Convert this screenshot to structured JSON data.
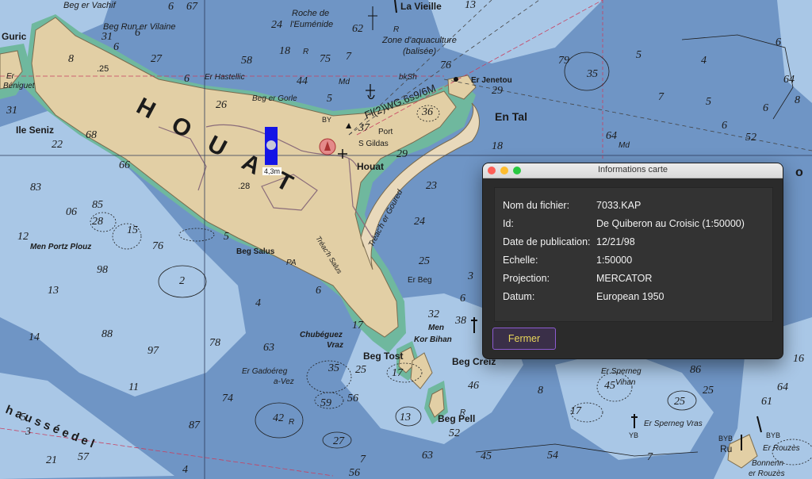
{
  "chart": {
    "places": {
      "houat": "H O U A T",
      "houat_port": "Houat",
      "guric": "Guric",
      "ile_seniz": "Ile Seniz",
      "beg_er_vachif": "Beg er Vachif",
      "beg_run_er_vilaine": "Beg Run er Vilaine",
      "roche_eumenide_1": "Roche de",
      "roche_eumenide_2": "l'Euménide",
      "la_vieille": "La Vieille",
      "zone_aquaculture_1": "Zone d'aquaculture",
      "zone_aquaculture_2": "(balisée)",
      "er_hastellic": "Er Hastellic",
      "beg_er_gorle": "Beg er Gorle",
      "er_beniguet_1": "Er",
      "er_beniguet_2": "Béniguet",
      "er_jenetou": "Er Jenetou",
      "en_tal": "En Tal",
      "port": "Port",
      "st_gildas": "S Gildas",
      "light": "Fl(2)WG.6s9/6M",
      "treach_er_goured": "Tréac'h er Goured",
      "treach_er_salus": "Tréac'h Salus",
      "men_portz_plouz": "Men Portz Plouz",
      "beg_salus": "Beg Salus",
      "er_beg": "Er Beg",
      "beg_creiz": "Beg Creiz",
      "beg_tost": "Beg Tost",
      "beg_pell": "Beg Pell",
      "chubeguez_1": "Chubéguez",
      "chubeguez_2": "Vraz",
      "men_kor_bihan_1": "Men",
      "men_kor_bihan_2": "Kor Bihan",
      "er_gadoereg_1": "Er Gadoéreg",
      "er_gadoereg_2": "a-Vez",
      "er_sperneg_vihan_1": "Er Sperneg",
      "er_sperneg_vihan_2": "Vihan",
      "er_sperneg_vras": "Er Sperneg Vras",
      "er_rouzes": "Er Rouzès",
      "bonnenn_1": "Bonnenn",
      "bonnenn_2": "er Rouzès",
      "chaussee": "h a u s s é e   d e   l",
      "by": "BY",
      "yb": "YB",
      "byb_1": "BYB",
      "byb_2": "BYB",
      "ru": "Ru",
      "md_1": "Md",
      "md_2": "Md",
      "bksh": "bkSh",
      "pa": "PA",
      "r_1": "R",
      "r_2": "R",
      "r_3": "R",
      "r_4": "R",
      "edge_o": "o"
    },
    "soundings": {
      "s1": "6",
      "s2": "67",
      "s3": "24",
      "s4": "62",
      "s5": "13",
      "s6": "57",
      "s7": "31",
      "s8": "27",
      "s9": "58",
      "s10": "18",
      "s11": "75",
      "s12": "7",
      "s13": "45",
      "s14": "4",
      "s15": "44",
      "s16": "76",
      "s17": "6",
      "s18": "5",
      "s19": "6",
      "s20": "6",
      "s21": "8",
      "s22": "4",
      "s23": "7",
      "s24": "21",
      "s25": "26",
      "s26": "56",
      "s27": "29",
      "s28": "7",
      "s29": "23",
      "s30": "36",
      "s31": "29",
      "s32": "37",
      "s33": "18",
      "s34": "3",
      "s35": "54",
      "s36": "79",
      "s37": "35",
      "s38": "5",
      "s39": "4",
      "s40": "6",
      "s41": "64",
      "s42": "68",
      "s43": "22",
      "s44": "66",
      "s45": "83",
      "s46": "85",
      "s47": "06",
      "s48": "28",
      "s49": "15",
      "s50": "12",
      "s51": "76",
      "s52": "98",
      "s53": "2",
      "s54": "25",
      "s55": "5",
      "s56": "24",
      "s57": "13",
      "s58": "14",
      "s59": "88",
      "s60": "78",
      "s61": "97",
      "s62": "63",
      "s63": "74",
      "s64": "11",
      "s65": "42",
      "s66": "87",
      "s67": "27",
      "s68": "63",
      "s69": "35",
      "s70": "59",
      "s71": "56",
      "s72": "25",
      "s73": "32",
      "s74": "38",
      "s75": "6",
      "s76": "17",
      "s77": "17",
      "s78": "13",
      "s79": "46",
      "s80": "52",
      "s81": "5",
      "s82": "8",
      "s83": "45",
      "s84": "17",
      "s85": "86",
      "s86": "25",
      "s87": "16",
      "s88": "61",
      "s89": "64",
      "s90": "6",
      "s91": "7",
      "s92": "64",
      "s93": "8",
      "s94": "6",
      "s95": "52",
      "s96": "5",
      "s97": "25",
      "s98": "28",
      "s99": "32",
      "s100": "3",
      "s101": "3",
      "s102": "5",
      "s103": "6",
      "s104": "31"
    },
    "heights": {
      "h1": ".25",
      "h2": ".28"
    }
  },
  "marker": {
    "label": "4,3m"
  },
  "dialog": {
    "title": "Informations carte",
    "rows": [
      {
        "key": "Nom du fichier:",
        "value": "7033.KAP"
      },
      {
        "key": "Id:",
        "value": "De Quiberon au Croisic (1:50000)"
      },
      {
        "key": "Date de publication:",
        "value": "12/21/98"
      },
      {
        "key": "Echelle:",
        "value": "1:50000"
      },
      {
        "key": "Projection:",
        "value": "MERCATOR"
      },
      {
        "key": "Datum:",
        "value": "European 1950"
      }
    ],
    "close_label": "Fermer"
  },
  "colors": {
    "sea_deep": "#6f95c5",
    "sea_shallow": "#a9c7e6",
    "land": "#e2cfa5",
    "foreshore": "#6fb89e",
    "accent": "#8c5bd1"
  }
}
